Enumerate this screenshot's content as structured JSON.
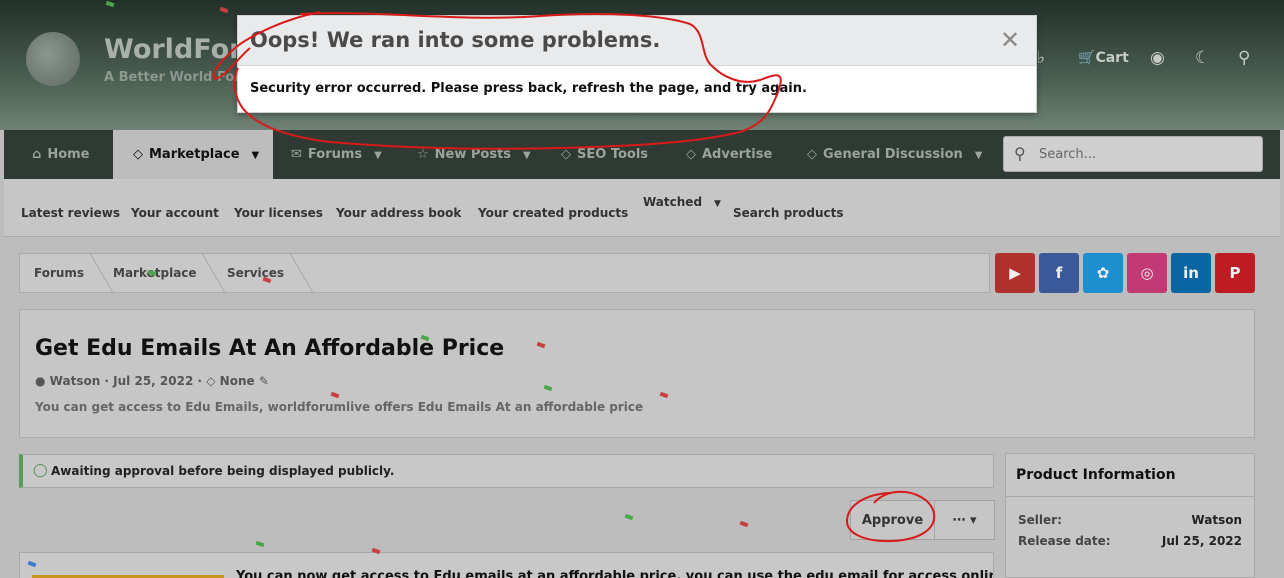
{
  "site": {
    "name": "WorldForu",
    "tagline": "A Better World For",
    "cart_label": "Cart"
  },
  "nav": {
    "items": [
      {
        "label": "Home"
      },
      {
        "label": "Marketplace"
      },
      {
        "label": "Forums"
      },
      {
        "label": "New Posts"
      },
      {
        "label": "SEO Tools"
      },
      {
        "label": "Advertise"
      },
      {
        "label": "General Discussion"
      }
    ],
    "search_placeholder": "Search..."
  },
  "subnav": {
    "items": [
      "Latest reviews",
      "Your account",
      "Your licenses",
      "Your address book",
      "Your created products",
      "Watched",
      "Search products"
    ]
  },
  "breadcrumb": [
    "Forums",
    "Marketplace",
    "Services"
  ],
  "social": {
    "youtube_color": "#b0302c",
    "facebook_color": "#3b5998",
    "twitter_color": "#1d8fcf",
    "instagram_color": "#c13a73",
    "linkedin_color": "#0a66a2",
    "pinterest_color": "#bd1c22"
  },
  "product": {
    "title": "Get Edu Emails At An Affordable Price",
    "author": "Watson",
    "date": "Jul 25, 2022",
    "tag": "None",
    "description": "You can get access to Edu Emails, worldforumlive offers Edu Emails At an affordable price",
    "awaiting_text": "Awaiting approval before being displayed publicly.",
    "approve_label": "Approve",
    "more_label": "⋯ ▾",
    "body_text": "You can now get access to Edu emails at an affordable price, you can use the edu email for access online"
  },
  "product_info": {
    "title": "Product Information",
    "seller_label": "Seller:",
    "seller_value": "Watson",
    "release_label": "Release date:",
    "release_value": "Jul 25, 2022"
  },
  "modal": {
    "title": "Oops! We ran into some problems.",
    "message": "Security error occurred. Please press back, refresh the page, and try again.",
    "close_glyph": "✕"
  },
  "annotation_color": "#d81a1a"
}
